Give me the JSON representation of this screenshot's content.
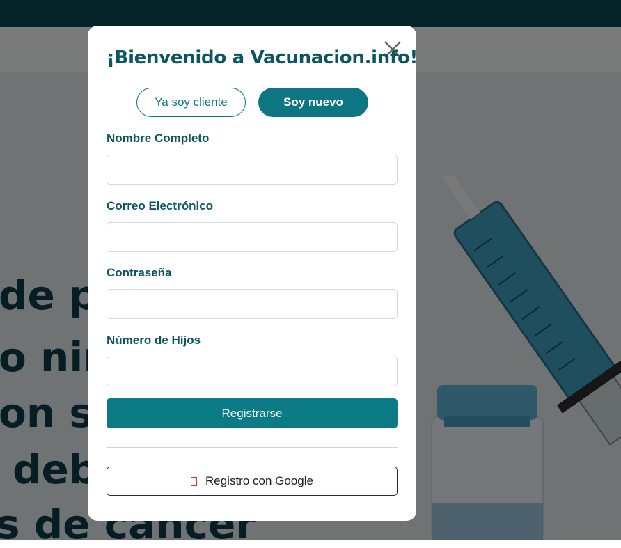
{
  "background_page": {
    "hero_lines": [
      "de p",
      "o niñ",
      "on si",
      "deb",
      "s de cancer"
    ]
  },
  "modal": {
    "title": "¡Bienvenido a Vacunacion.info!",
    "tabs": [
      {
        "label": "Ya soy cliente",
        "active": false
      },
      {
        "label": "Soy nuevo",
        "active": true
      }
    ],
    "fields": [
      {
        "label": "Nombre Completo",
        "value": "",
        "placeholder": ""
      },
      {
        "label": "Correo Electrónico",
        "value": "",
        "placeholder": ""
      },
      {
        "label": "Contraseña",
        "value": "",
        "placeholder": ""
      },
      {
        "label": "Número de Hijos",
        "value": "",
        "placeholder": ""
      }
    ],
    "submit_label": "Registrarse",
    "google_label": "Registro con Google",
    "icons": {
      "close": "close-icon",
      "google": "google-icon"
    }
  },
  "colors": {
    "brand_dark": "#0b5660",
    "brand_primary": "#0e7683",
    "topbar": "#0b4550",
    "google_icon": "#d9302c"
  }
}
